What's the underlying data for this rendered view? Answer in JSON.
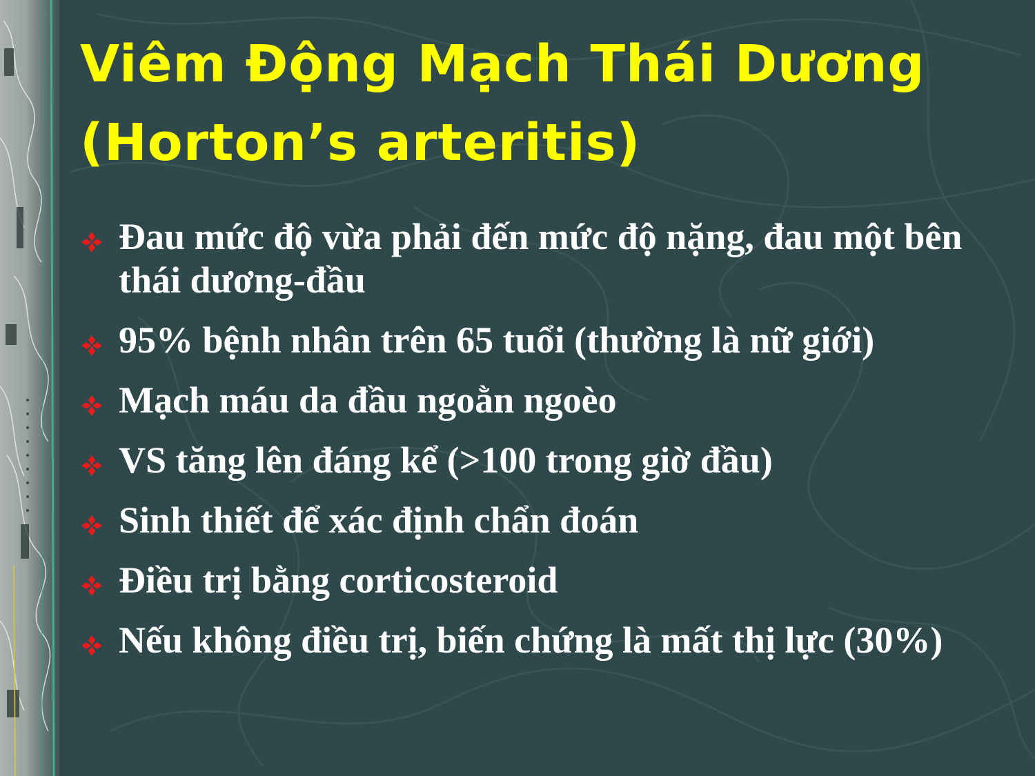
{
  "slide": {
    "title_line1": "Viêm Động Mạch Thái Dương",
    "title_line2": "(Horton’s arteritis)",
    "title_color": "#ffff00",
    "bullet_icon": "red-four-diamond-bullet-icon",
    "bullet_color": "#e81c1c",
    "background_color": "#2e484b"
  },
  "bullets": [
    "Đau mức độ vừa phải đến mức độ nặng, đau một bên thái dương-đầu",
    "95% bệnh nhân trên 65 tuổi (thường là nữ giới)",
    "Mạch máu da đầu ngoằn ngoèo",
    "VS tăng lên đáng kể (>100 trong giờ đầu)",
    "Sinh thiết để xác định chẩn đoán",
    "Điều trị bằng corticosteroid",
    "Nếu không điều trị, biến chứng là mất thị lực (30%)"
  ]
}
